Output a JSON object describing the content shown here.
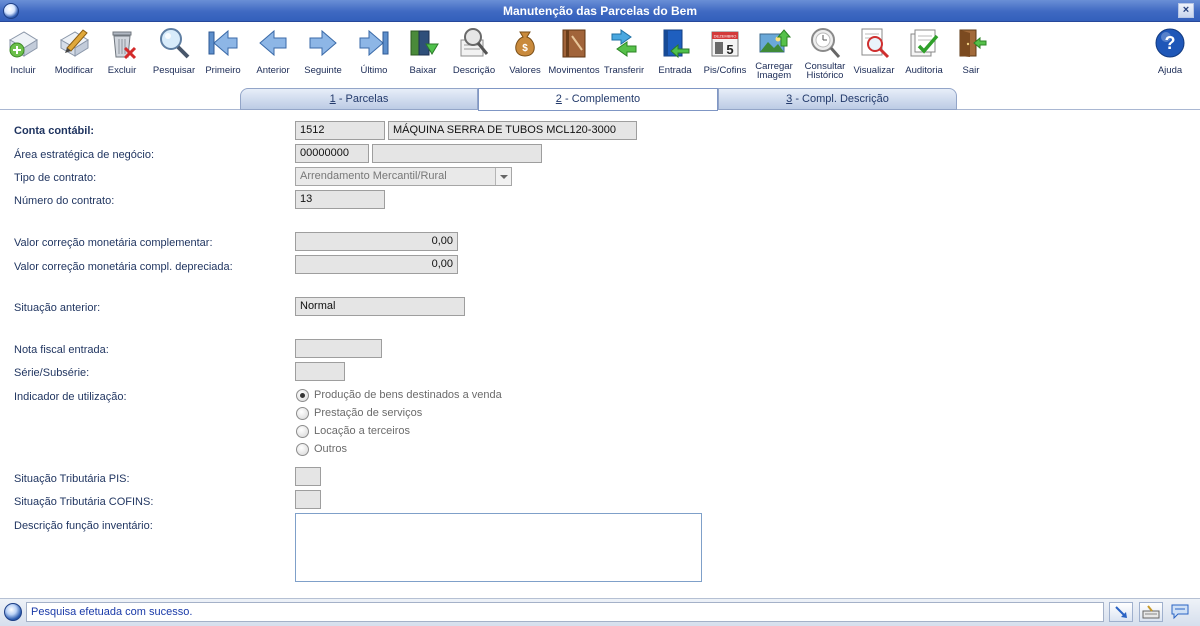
{
  "window": {
    "title": "Manutenção das Parcelas do Bem",
    "close_label": "×"
  },
  "toolbar": [
    {
      "id": "incluir",
      "label": "Incluir"
    },
    {
      "id": "modificar",
      "label": "Modificar"
    },
    {
      "id": "excluir",
      "label": "Excluir"
    },
    {
      "id": "pesquisar",
      "label": "Pesquisar"
    },
    {
      "id": "primeiro",
      "label": "Primeiro"
    },
    {
      "id": "anterior",
      "label": "Anterior"
    },
    {
      "id": "seguinte",
      "label": "Seguinte"
    },
    {
      "id": "ultimo",
      "label": "Último"
    },
    {
      "id": "baixar",
      "label": "Baixar"
    },
    {
      "id": "descricao",
      "label": "Descrição"
    },
    {
      "id": "valores",
      "label": "Valores"
    },
    {
      "id": "movimentos",
      "label": "Movimentos"
    },
    {
      "id": "transferir",
      "label": "Transferir"
    },
    {
      "id": "entrada",
      "label": "Entrada"
    },
    {
      "id": "piscofins",
      "label": "Pis/Cofins"
    },
    {
      "id": "carregar",
      "label": "Carregar Imagem"
    },
    {
      "id": "consultar",
      "label": "Consultar Histórico"
    },
    {
      "id": "visualizar",
      "label": "Visualizar"
    },
    {
      "id": "auditoria",
      "label": "Auditoria"
    },
    {
      "id": "sair",
      "label": "Sair"
    },
    {
      "id": "ajuda",
      "label": "Ajuda"
    }
  ],
  "calendar_icon_text": {
    "month": "DEZEMBRO",
    "day": "5"
  },
  "tabs": [
    {
      "key": "1",
      "label": " - Parcelas"
    },
    {
      "key": "2",
      "label": " - Complemento",
      "active": true
    },
    {
      "key": "3",
      "label": " - Compl. Descrição"
    }
  ],
  "form": {
    "conta_contabil": {
      "label": "Conta contábil:",
      "code": "1512",
      "desc": "MÁQUINA SERRA DE TUBOS MCL120-3000"
    },
    "area_estrategica": {
      "label": "Área estratégica de negócio:",
      "code": "00000000",
      "desc": ""
    },
    "tipo_contrato": {
      "label": "Tipo de contrato:",
      "value": "Arrendamento Mercantil/Rural"
    },
    "numero_contrato": {
      "label": "Número do contrato:",
      "value": "13"
    },
    "valor_correcao": {
      "label": "Valor correção monetária complementar:",
      "value": "0,00"
    },
    "valor_correcao_depreciada": {
      "label": "Valor correção monetária compl. depreciada:",
      "value": "0,00"
    },
    "situacao_anterior": {
      "label": "Situação anterior:",
      "value": "Normal"
    },
    "nota_fiscal": {
      "label": "Nota fiscal entrada:",
      "value": ""
    },
    "serie": {
      "label": "Série/Subsérie:",
      "value": ""
    },
    "indicador": {
      "label": "Indicador de utilização:",
      "options": [
        {
          "label": "Produção de bens destinados a venda",
          "selected": true
        },
        {
          "label": "Prestação de serviços",
          "selected": false
        },
        {
          "label": "Locação a terceiros",
          "selected": false
        },
        {
          "label": "Outros",
          "selected": false
        }
      ]
    },
    "situacao_pis": {
      "label": "Situação Tributária PIS:",
      "value": ""
    },
    "situacao_cofins": {
      "label": "Situação Tributária COFINS:",
      "value": ""
    },
    "descricao_funcao": {
      "label": "Descrição função inventário:",
      "value": ""
    }
  },
  "status": {
    "message": "Pesquisa efetuada com sucesso."
  }
}
